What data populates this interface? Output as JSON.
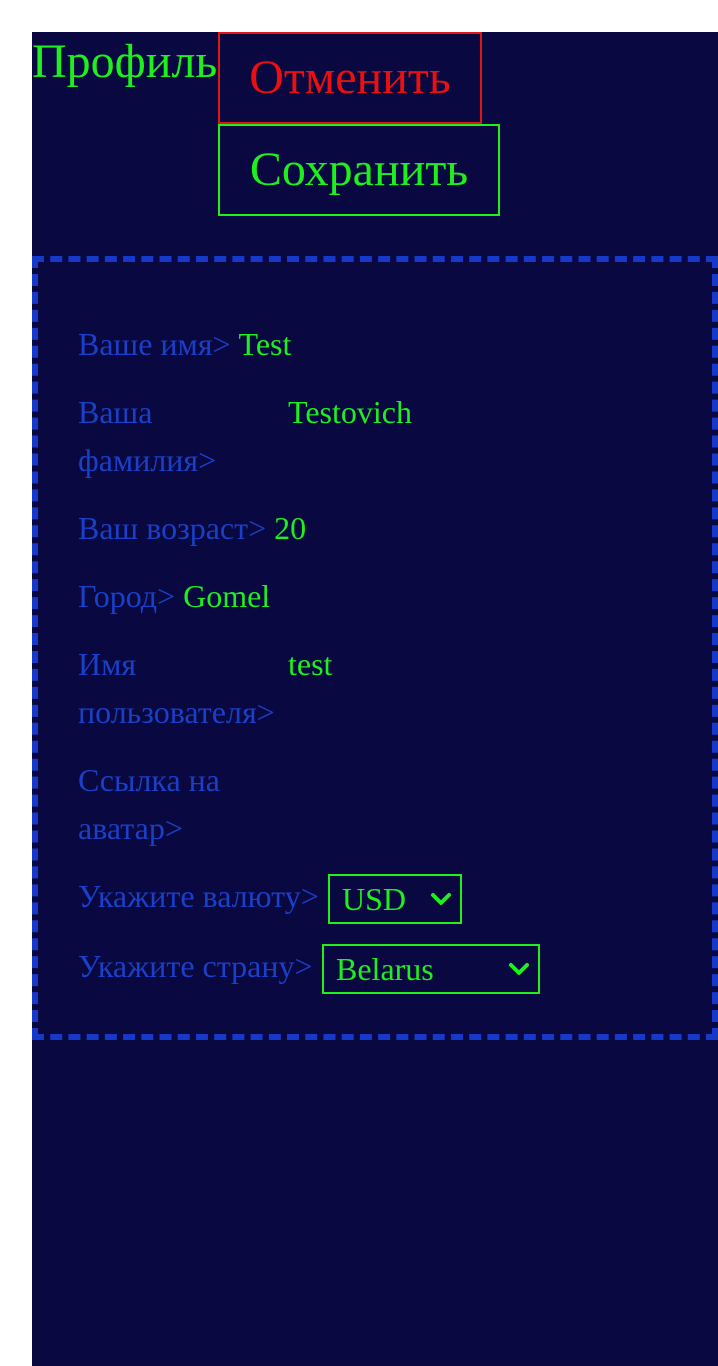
{
  "header": {
    "title": "Профиль",
    "cancel_label": "Отменить",
    "save_label": "Сохранить"
  },
  "form": {
    "name": {
      "label": "Ваше имя>",
      "value": "Test"
    },
    "surname": {
      "label_line1": "Ваша",
      "label_line2": "фамилия>",
      "value": "Testovich"
    },
    "age": {
      "label": "Ваш возраст>",
      "value": "20"
    },
    "city": {
      "label": "Город>",
      "value": "Gomel"
    },
    "username": {
      "label_line1": "Имя",
      "label_line2": "пользователя>",
      "value": "test"
    },
    "avatar": {
      "label_line1": "Ссылка на",
      "label_line2": "аватар>",
      "value": ""
    },
    "currency": {
      "label": "Укажите валюту>",
      "selected": "USD"
    },
    "country": {
      "label": "Укажите страну>",
      "selected": "Belarus"
    }
  },
  "icons": {
    "currency_dropdown": "chevron-down-icon",
    "country_dropdown": "chevron-down-icon"
  },
  "colors": {
    "background": "#0a0840",
    "page_background": "#ffffff",
    "accent_green": "#1ef01e",
    "label_blue": "#1a3fc8",
    "panel_border": "#1639c9",
    "cancel_red": "#e81010"
  }
}
